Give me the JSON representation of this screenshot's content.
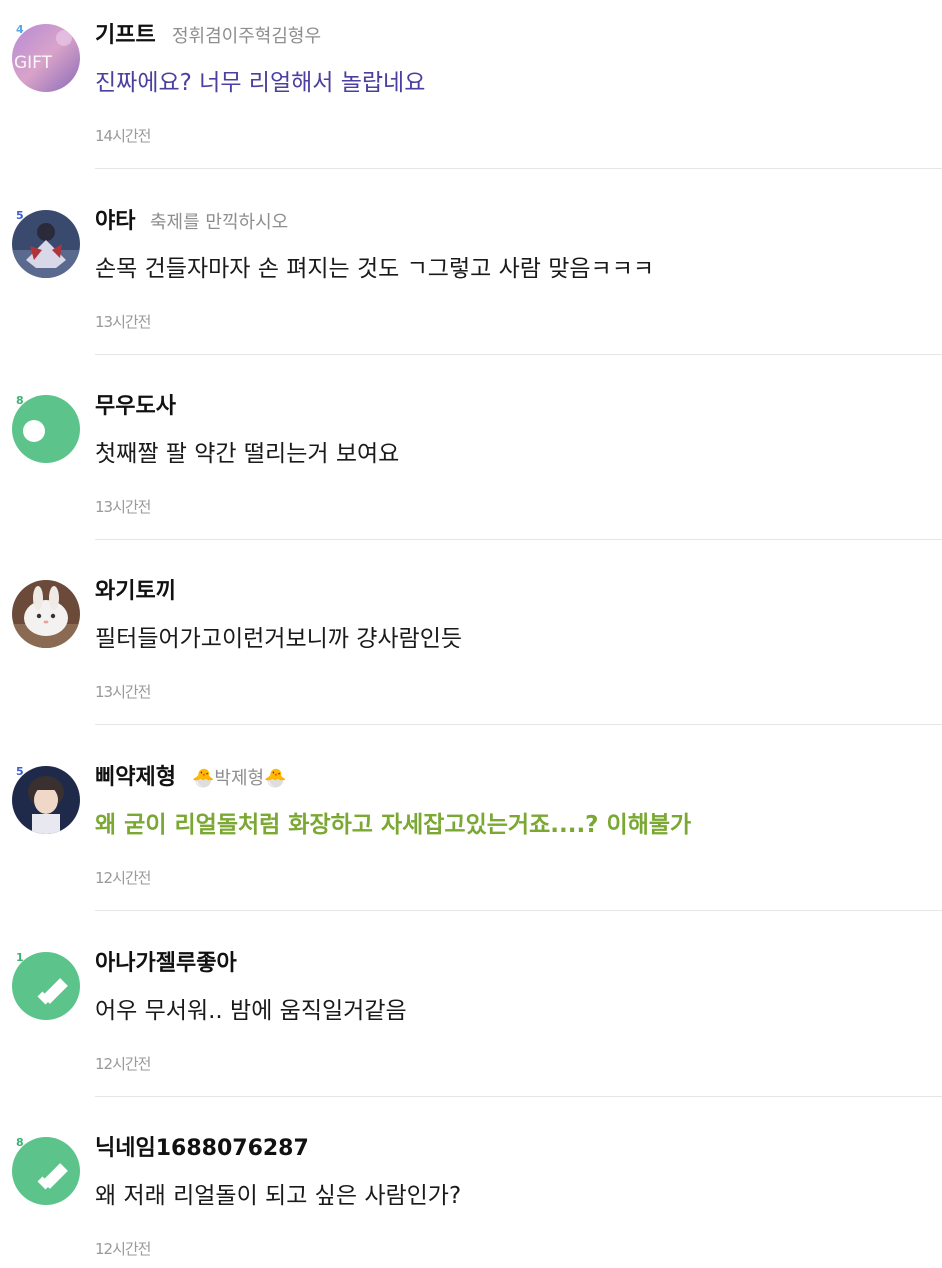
{
  "comments": [
    {
      "level": "4",
      "level_color": "#5aa7e6",
      "avatar_text": "GIFT",
      "nickname": "기프트",
      "title_tag": "정휘겸이주혁김형우",
      "text": "진짜에요? 너무 리얼해서 놀랍네요",
      "text_color": "#4b3fa0",
      "time": "14시간전"
    },
    {
      "level": "5",
      "level_color": "#3b5fd0",
      "nickname": "야타",
      "title_tag": "축제를 만끽하시오",
      "text": " 손목 건들자마자 손 펴지는 것도 ㄱ그렇고 사람 맞음ㅋㅋㅋ",
      "text_color": "#1a1a1a",
      "time": "13시간전"
    },
    {
      "level": "8",
      "level_color": "#3cb371",
      "nickname": "무우도사",
      "title_tag": "",
      "text": "첫째짤 팔 약간 떨리는거 보여요",
      "text_color": "#1a1a1a",
      "time": "13시간전"
    },
    {
      "level": "",
      "level_color": "#3cb371",
      "nickname": "와기토끼",
      "title_tag": "",
      "text": "필터들어가고이런거보니까 걍사람인듯",
      "text_color": "#1a1a1a",
      "time": "13시간전"
    },
    {
      "level": "5",
      "level_color": "#3b5fd0",
      "nickname": "삐약제형",
      "title_tag": "🐣박제형🐣",
      "text": " 왜 굳이 리얼돌처럼 화장하고 자세잡고있는거죠....? 이해불가",
      "text_color": "#7aa832",
      "time": "12시간전"
    },
    {
      "level": "1",
      "level_color": "#3cb371",
      "nickname": "아나가젤루좋아",
      "title_tag": "",
      "text": "어우 무서워.. 밤에 움직일거같음",
      "text_color": "#1a1a1a",
      "time": "12시간전"
    },
    {
      "level": "8",
      "level_color": "#3cb371",
      "nickname": "닉네임1688076287",
      "title_tag": "",
      "text": "왜 저래 리얼돌이 되고 싶은 사람인가?",
      "text_color": "#1a1a1a",
      "time": "12시간전"
    }
  ],
  "colors": {
    "default_avatar": "#5cc48a",
    "divider": "#e6e6e6",
    "time": "#9a9a9a",
    "title_tag": "#8e8e8e"
  }
}
